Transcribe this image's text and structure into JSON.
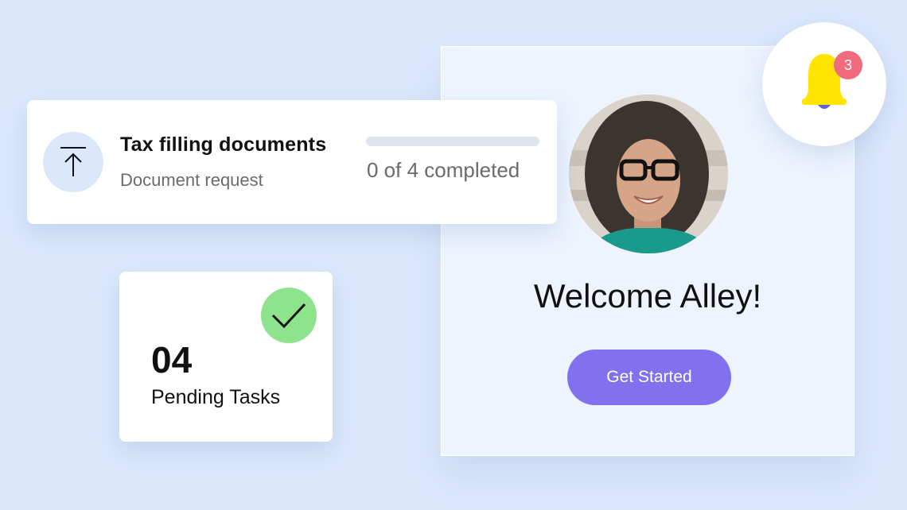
{
  "welcome": {
    "title": "Welcome Alley!",
    "button_label": "Get Started",
    "avatar_icon": "user-avatar-photo"
  },
  "notifications": {
    "icon": "bell-icon",
    "count": "3"
  },
  "document": {
    "title": "Tax filling documents",
    "subtitle": "Document request",
    "icon": "upload-icon",
    "progress_text": "0 of 4 completed",
    "progress_fraction": 0
  },
  "tasks": {
    "count": "04",
    "label": "Pending Tasks",
    "icon": "check-icon"
  },
  "colors": {
    "background": "#dbe8fc",
    "accent": "#8271ee",
    "badge": "#f06b7e",
    "bell": "#ffe500",
    "check": "#8ee48c"
  }
}
